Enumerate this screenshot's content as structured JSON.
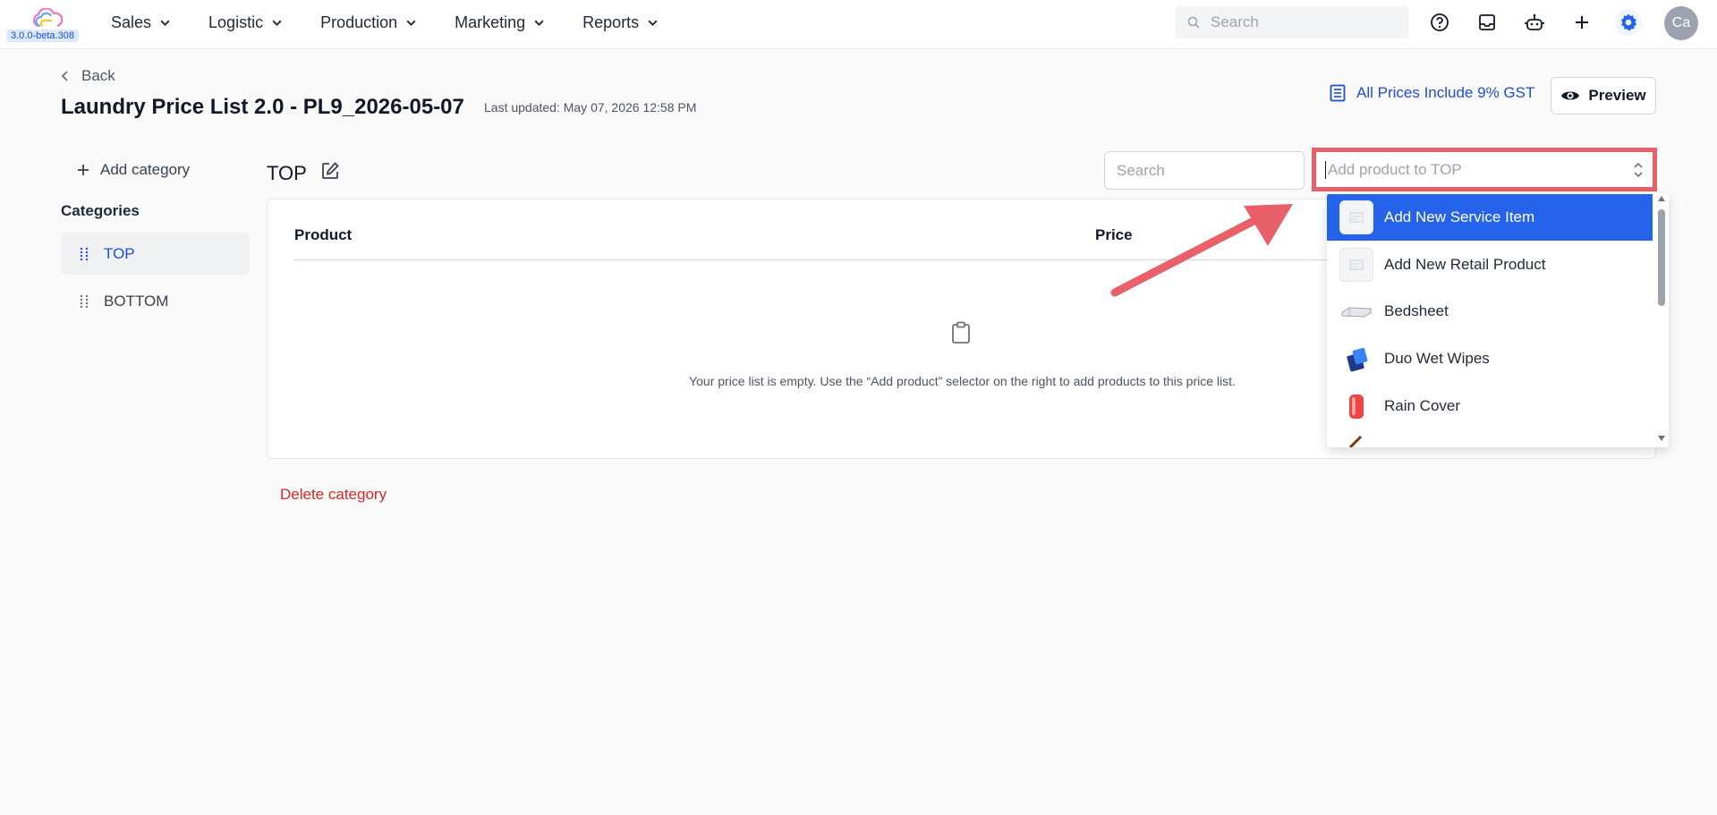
{
  "app": {
    "version": "3.0.0-beta.308",
    "colors": {
      "accent": "#2563eb",
      "danger": "#dc2626",
      "annotation": "#e8606a"
    }
  },
  "nav": {
    "items": [
      {
        "label": "Sales"
      },
      {
        "label": "Logistic"
      },
      {
        "label": "Production"
      },
      {
        "label": "Marketing"
      },
      {
        "label": "Reports"
      }
    ],
    "search_placeholder": "Search",
    "icons": [
      "help-icon",
      "inbox-icon",
      "robot-icon",
      "plus-icon",
      "gear-icon"
    ],
    "avatar_initials": "Ca"
  },
  "header": {
    "back_label": "Back",
    "title": "Laundry Price List 2.0 - PL9_2026-05-07",
    "last_updated": "Last updated: May 07, 2026 12:58 PM",
    "gst_label": "All Prices Include 9% GST",
    "preview_label": "Preview"
  },
  "sidebar": {
    "add_category_label": "Add category",
    "categories_label": "Categories",
    "categories": [
      {
        "label": "TOP",
        "active": true
      },
      {
        "label": "BOTTOM",
        "active": false
      }
    ]
  },
  "main": {
    "section_title": "TOP",
    "search_placeholder": "Search",
    "add_product_placeholder": "Add product to TOP",
    "table": {
      "columns": [
        "Product",
        "Price"
      ],
      "empty_message": "Your price list is empty. Use the “Add product” selector on the right to add products to this price list."
    },
    "delete_category_label": "Delete category"
  },
  "dropdown": {
    "items": [
      {
        "label": "Add New Service Item",
        "highlighted": true,
        "icon": "placeholder-image-icon"
      },
      {
        "label": "Add New Retail Product",
        "highlighted": false,
        "icon": "placeholder-image-icon"
      },
      {
        "label": "Bedsheet",
        "highlighted": false,
        "icon": "bedsheet-icon"
      },
      {
        "label": "Duo Wet Wipes",
        "highlighted": false,
        "icon": "wet-wipes-icon"
      },
      {
        "label": "Rain Cover",
        "highlighted": false,
        "icon": "rain-cover-icon"
      }
    ]
  }
}
